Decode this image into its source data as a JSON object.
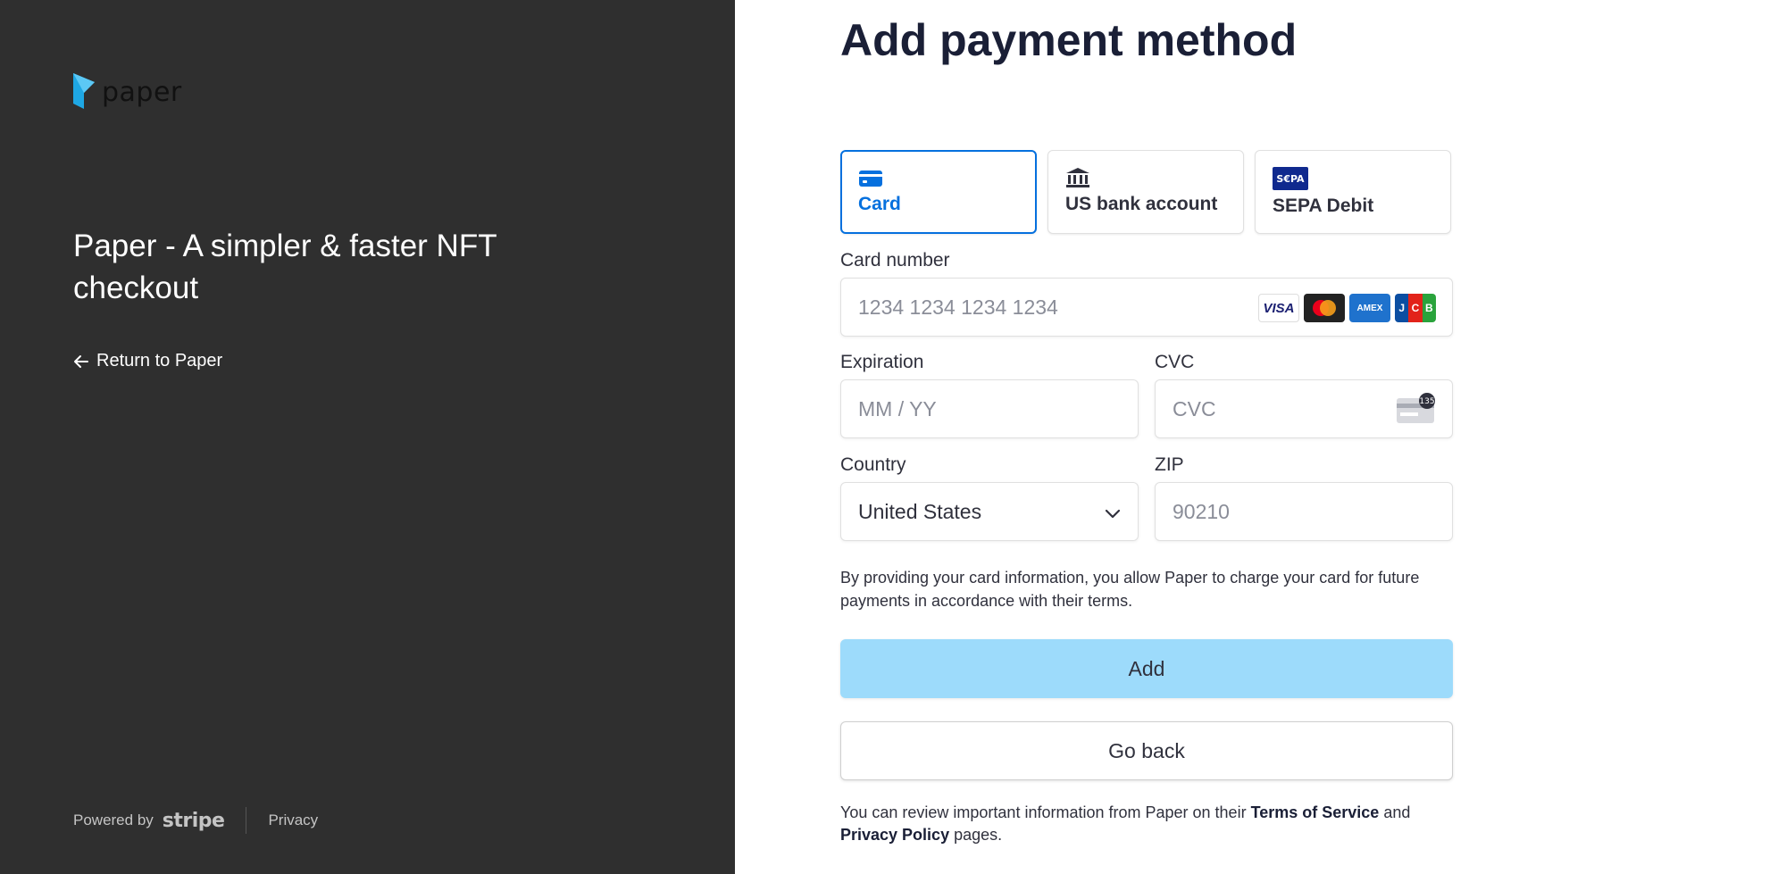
{
  "sidebar": {
    "logo_text": "paper",
    "headline": "Paper - A simpler & faster NFT checkout",
    "return_link": "Return to Paper",
    "footer": {
      "powered_by": "Powered by",
      "brand": "stripe",
      "privacy": "Privacy"
    }
  },
  "main": {
    "title": "Add payment method",
    "tabs": [
      {
        "label": "Card",
        "icon": "credit-card-icon",
        "active": true
      },
      {
        "label": "US bank account",
        "icon": "bank-icon",
        "active": false
      },
      {
        "label": "SEPA Debit",
        "icon": "sepa-icon",
        "active": false
      }
    ],
    "card_number": {
      "label": "Card number",
      "placeholder": "1234 1234 1234 1234",
      "brands": [
        "VISA",
        "Mastercard",
        "AMEX",
        "JCB"
      ]
    },
    "expiration": {
      "label": "Expiration",
      "placeholder": "MM / YY"
    },
    "cvc": {
      "label": "CVC",
      "placeholder": "CVC",
      "icon_text": "135"
    },
    "country": {
      "label": "Country",
      "value": "United States"
    },
    "zip": {
      "label": "ZIP",
      "placeholder": "90210"
    },
    "notice": "By providing your card information, you allow Paper to charge your card for future payments in accordance with their terms.",
    "add_button": "Add",
    "back_button": "Go back",
    "legal": {
      "prefix": "You can review important information from Paper on their",
      "terms": "Terms of Service",
      "and": "and",
      "privacy": "Privacy Policy",
      "suffix": "pages."
    }
  },
  "colors": {
    "sidebar_bg": "#2f2f2f",
    "accent": "#0570de",
    "add_button_bg": "#9ddbfb",
    "logo_accent": "#1ea7e4"
  }
}
